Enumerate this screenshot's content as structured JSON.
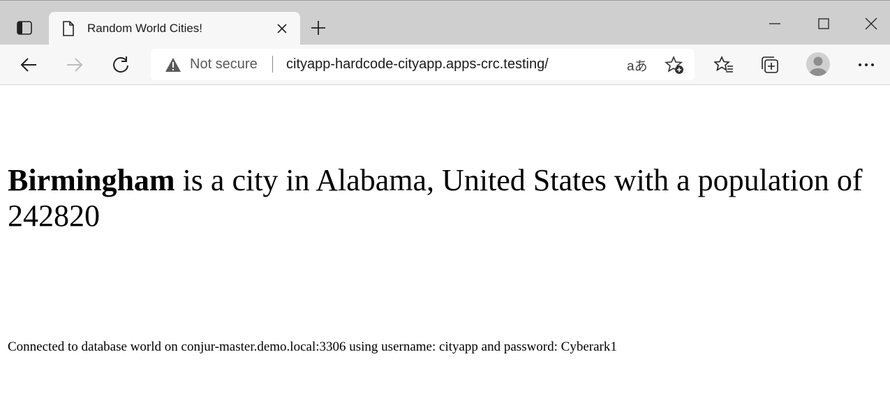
{
  "browser": {
    "tab": {
      "title": "Random World Cities!"
    },
    "address_bar": {
      "security_label": "Not secure",
      "url": "cityapp-hardcode-cityapp.apps-crc.testing/",
      "read_aloud_glyph": "aあ"
    },
    "icons": {
      "tab_actions": "tab-actions-icon",
      "favicon": "page-icon",
      "tab_close": "close-icon",
      "new_tab": "plus-icon",
      "minimize": "minimize-icon",
      "maximize": "maximize-icon",
      "close_window": "close-icon",
      "back": "back-arrow-icon",
      "forward": "forward-arrow-icon",
      "refresh": "refresh-icon",
      "warning": "warning-icon",
      "add_favorite": "star-plus-icon",
      "favorites": "favorites-icon",
      "collections": "collections-icon",
      "profile": "profile-avatar-icon",
      "more": "more-icon"
    }
  },
  "page": {
    "city": "Birmingham",
    "sentence": " is a city in Alabama, United States with a population of 242820",
    "db_info": "Connected to database world on conjur-master.demo.local:3306 using username: cityapp and password: Cyberark1"
  }
}
